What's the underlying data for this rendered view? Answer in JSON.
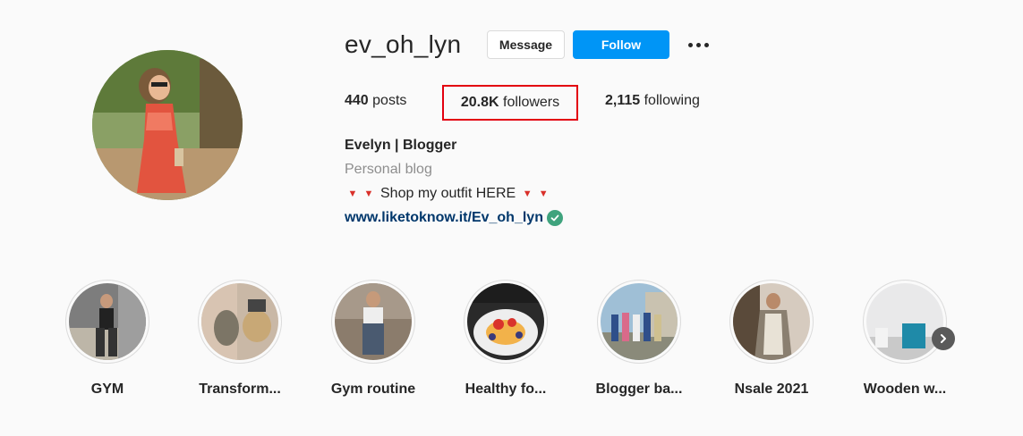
{
  "profile": {
    "username": "ev_oh_lyn",
    "message_label": "Message",
    "follow_label": "Follow",
    "stats": {
      "posts_count": "440",
      "posts_label": "posts",
      "followers_count": "20.8K",
      "followers_label": "followers",
      "following_count": "2,115",
      "following_label": "following"
    },
    "bio": {
      "name": "Evelyn | Blogger",
      "category": "Personal blog",
      "text": "Shop my outfit HERE",
      "link": "www.liketoknow.it/Ev_oh_lyn"
    }
  },
  "highlights": [
    {
      "label": "GYM"
    },
    {
      "label": "Transform..."
    },
    {
      "label": "Gym routine"
    },
    {
      "label": "Healthy fo..."
    },
    {
      "label": "Blogger ba..."
    },
    {
      "label": "Nsale 2021"
    },
    {
      "label": "Wooden w..."
    }
  ],
  "icons": {
    "more": "more-options-icon",
    "verified": "verified-badge-icon",
    "next": "chevron-right-icon"
  },
  "colors": {
    "follow_button": "#0095f6",
    "link": "#00376b",
    "highlight_box": "#e3000f",
    "verified": "#3fa37d"
  }
}
